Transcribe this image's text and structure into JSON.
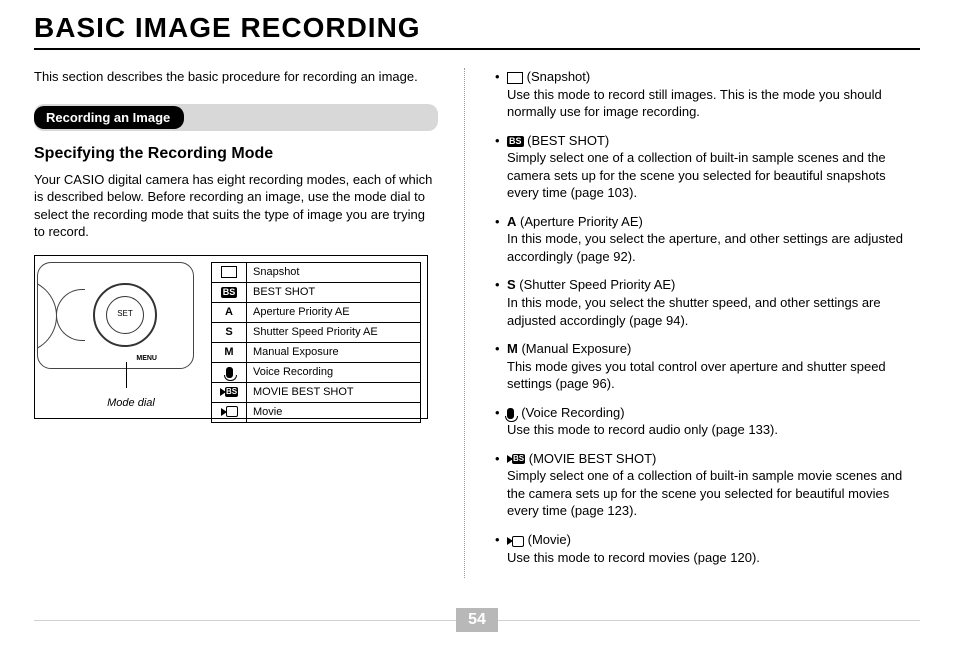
{
  "title": "BASIC IMAGE RECORDING",
  "page_number": "54",
  "intro": "This section describes the basic procedure for recording an image.",
  "section_label": "Recording an Image",
  "subhead": "Specifying the Recording Mode",
  "subhead_para": "Your CASIO digital camera has eight recording modes, each of which is described below. Before recording an image, use the mode dial to select the recording mode that suits the type of image you are trying to record.",
  "figure_caption": "Mode dial",
  "table": [
    {
      "icon": "snapshot-icon",
      "label": "Snapshot"
    },
    {
      "icon": "bs-icon",
      "icon_text": "BS",
      "label": "BEST SHOT"
    },
    {
      "icon": "letter",
      "icon_text": "A",
      "label": "Aperture Priority AE"
    },
    {
      "icon": "letter",
      "icon_text": "S",
      "label": "Shutter Speed Priority AE"
    },
    {
      "icon": "letter",
      "icon_text": "M",
      "label": "Manual Exposure"
    },
    {
      "icon": "mic-icon",
      "label": "Voice Recording"
    },
    {
      "icon": "movie-bs-icon",
      "icon_text": "BS",
      "label": "MOVIE BEST SHOT"
    },
    {
      "icon": "movie-icon",
      "label": "Movie"
    }
  ],
  "right_items": [
    {
      "icon": "snapshot-icon",
      "head": "(Snapshot)",
      "body": "Use this mode to record still images. This is the mode you should normally use for image recording."
    },
    {
      "icon": "bs-icon",
      "icon_text": "BS",
      "head": "(BEST SHOT)",
      "body": "Simply select one of a collection of built-in sample scenes and the camera sets up for the scene you selected for beautiful snapshots every time (page 103)."
    },
    {
      "letter": "A",
      "head": "(Aperture Priority AE)",
      "body": "In this mode, you select the aperture, and other settings are adjusted accordingly (page 92)."
    },
    {
      "letter": "S",
      "head": "(Shutter Speed Priority AE)",
      "body": "In this mode, you select the shutter speed, and other settings are adjusted accordingly (page 94)."
    },
    {
      "letter": "M",
      "head": "(Manual Exposure)",
      "body": "This mode gives you total control over aperture and shutter speed settings (page 96)."
    },
    {
      "icon": "mic-icon",
      "head": "(Voice Recording)",
      "body": "Use this mode to record audio only (page 133)."
    },
    {
      "icon": "movie-bs-icon",
      "icon_text": "BS",
      "head": "(MOVIE BEST SHOT)",
      "body": "Simply select one of a collection of built-in sample movie scenes and the camera sets up for the scene you selected for beautiful movies every time (page 123)."
    },
    {
      "icon": "movie-icon",
      "head": "(Movie)",
      "body": "Use this mode to record movies (page 120)."
    }
  ]
}
